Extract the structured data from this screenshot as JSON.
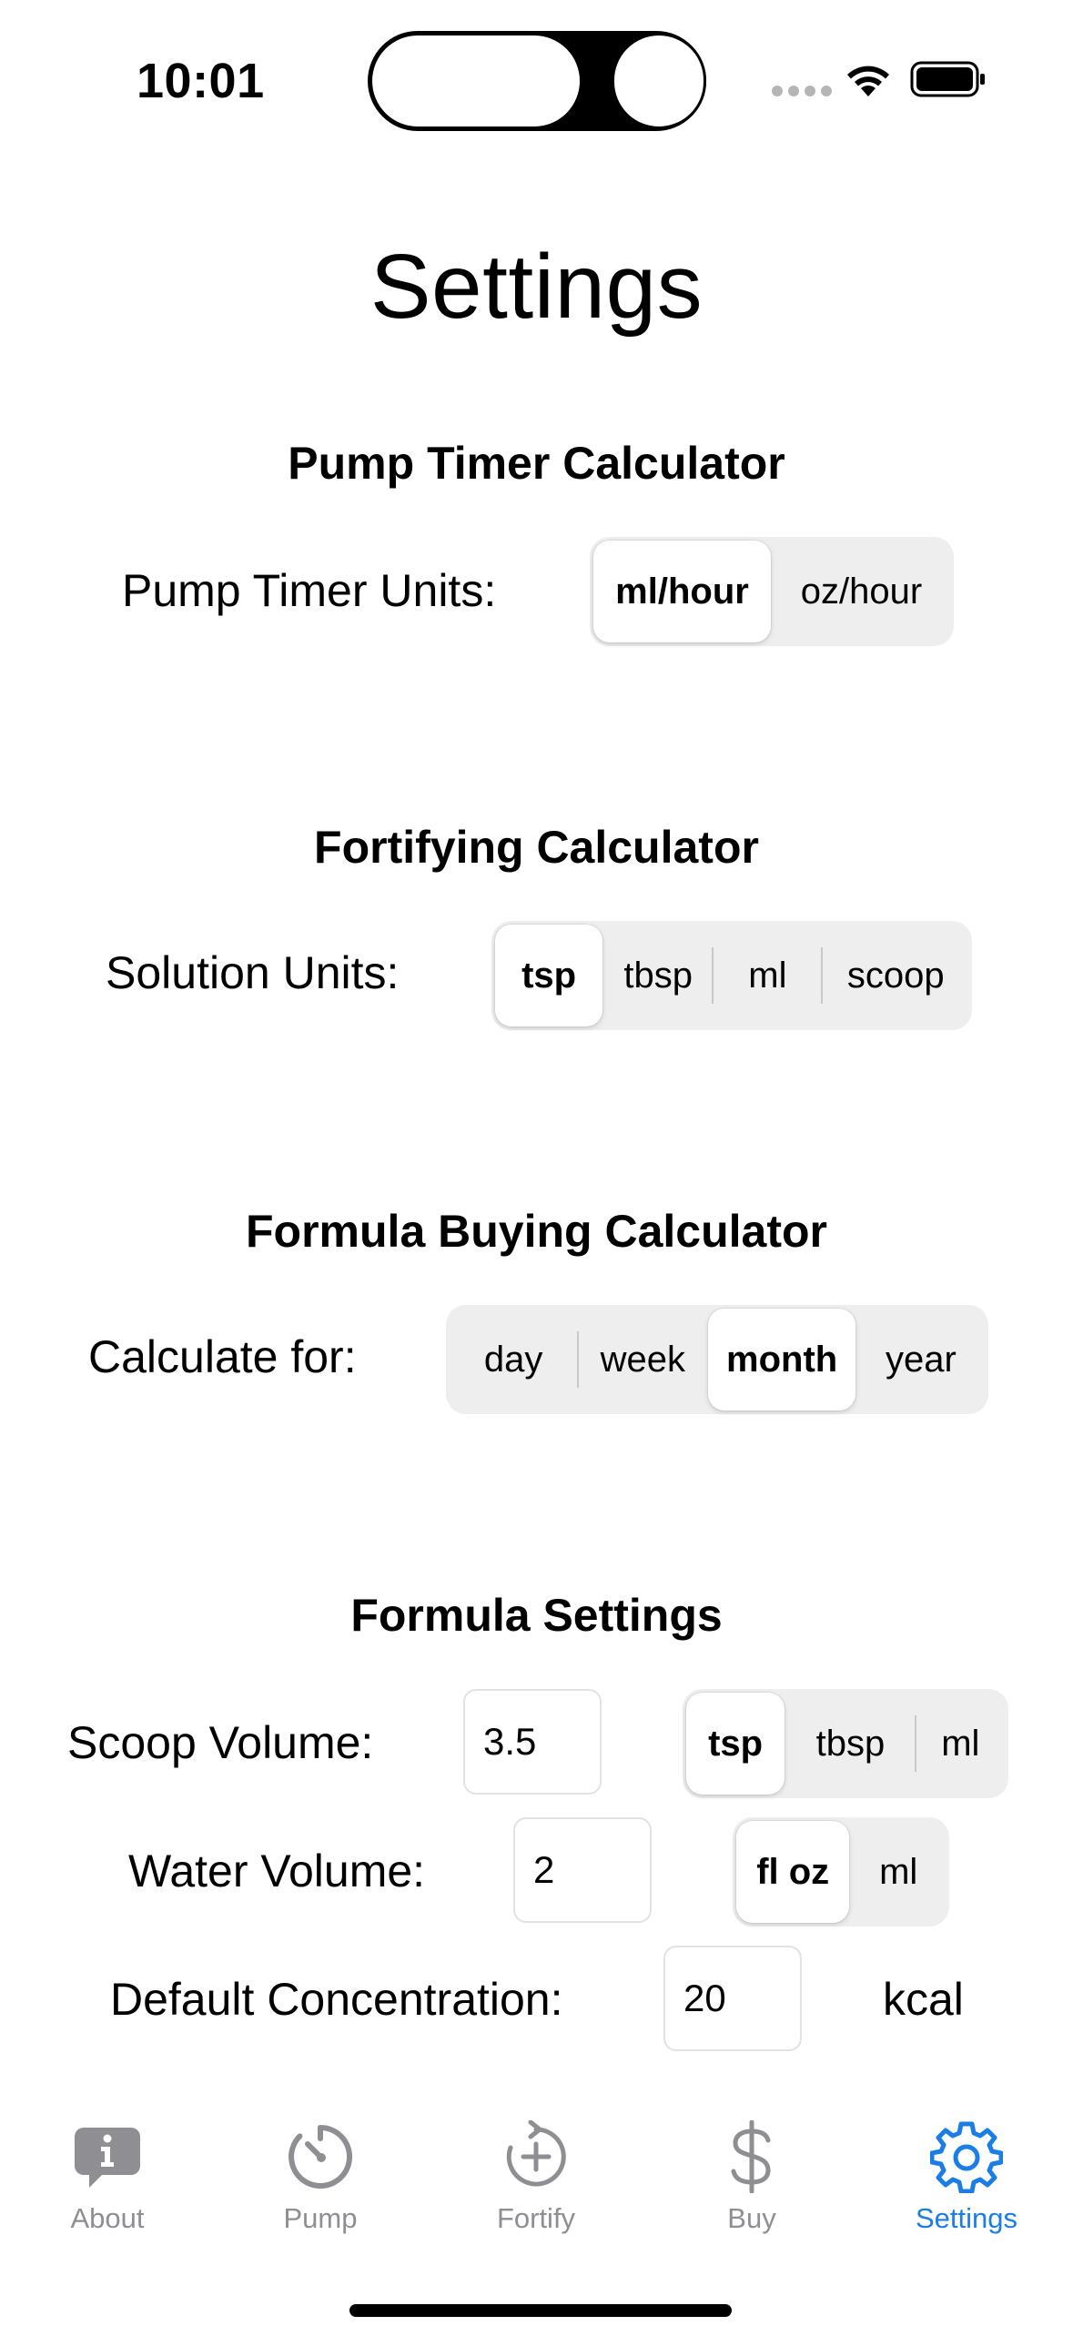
{
  "status_bar": {
    "time": "10:01"
  },
  "title": "Settings",
  "pump_timer": {
    "section_title": "Pump Timer Calculator",
    "label": "Pump Timer Units:",
    "options": [
      "ml/hour",
      "oz/hour"
    ],
    "selected": "ml/hour"
  },
  "fortifying": {
    "section_title": "Fortifying Calculator",
    "label": "Solution Units:",
    "options": [
      "tsp",
      "tbsp",
      "ml",
      "scoop"
    ],
    "selected": "tsp"
  },
  "formula_buying": {
    "section_title": "Formula Buying Calculator",
    "label": "Calculate for:",
    "options": [
      "day",
      "week",
      "month",
      "year"
    ],
    "selected": "month"
  },
  "formula_settings": {
    "section_title": "Formula Settings",
    "scoop_volume": {
      "label": "Scoop Volume:",
      "value": "3.5",
      "options": [
        "tsp",
        "tbsp",
        "ml"
      ],
      "selected": "tsp"
    },
    "water_volume": {
      "label": "Water Volume:",
      "value": "2",
      "options": [
        "fl oz",
        "ml"
      ],
      "selected": "fl oz"
    },
    "default_concentration": {
      "label": "Default Concentration:",
      "value": "20",
      "unit": "kcal"
    }
  },
  "tab_bar": {
    "items": [
      {
        "label": "About",
        "icon": "info-bubble-icon"
      },
      {
        "label": "Pump",
        "icon": "timer-gauge-icon"
      },
      {
        "label": "Fortify",
        "icon": "circular-arrow-plus-icon"
      },
      {
        "label": "Buy",
        "icon": "dollar-sign-icon"
      },
      {
        "label": "Settings",
        "icon": "gear-icon"
      }
    ],
    "active": "Settings"
  },
  "colors": {
    "accent": "#1a7ee6",
    "inactive": "#8e8e93",
    "segment_bg": "#eeeeef"
  }
}
